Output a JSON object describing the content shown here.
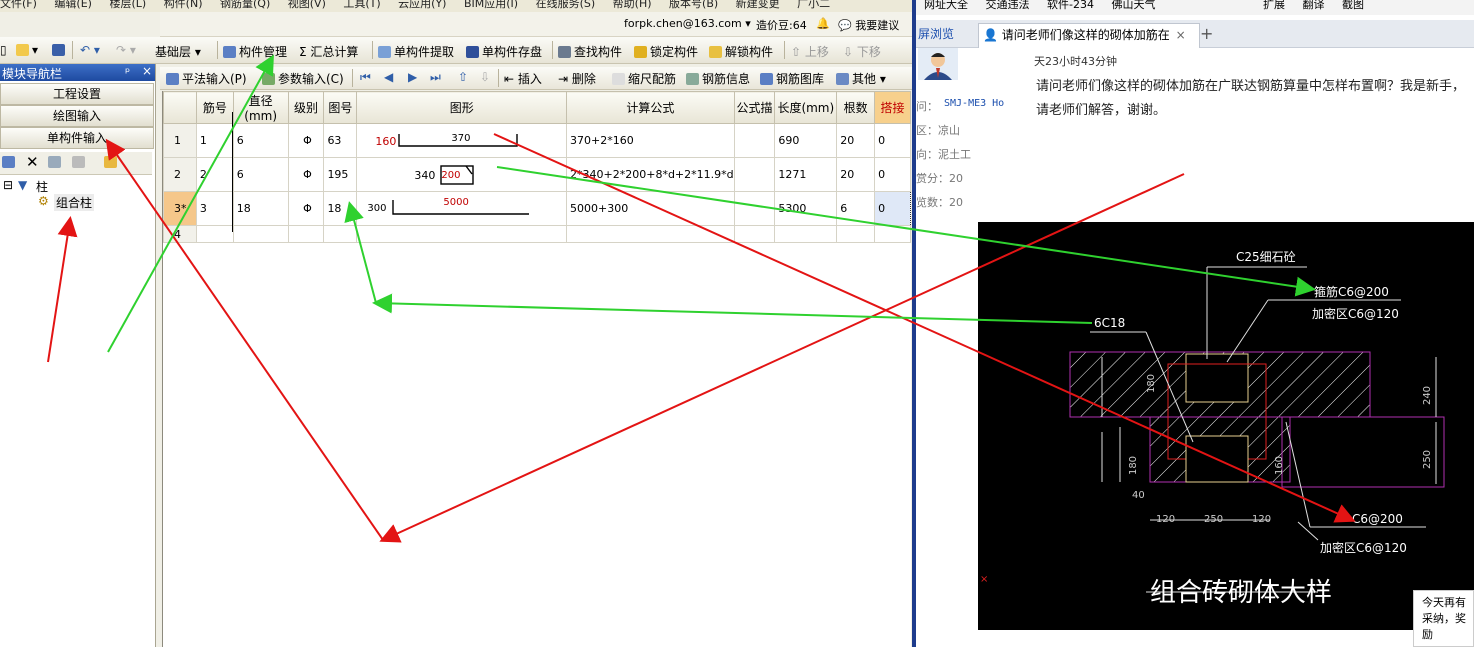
{
  "menubar": [
    "文件(F)",
    "编辑(E)",
    "楼层(L)",
    "构件(N)",
    "钢筋量(Q)",
    "视图(V)",
    "工具(T)",
    "云应用(Y)",
    "BIM应用(I)",
    "在线服务(S)",
    "帮助(H)",
    "版本号(B)",
    "新建变更",
    "广小二"
  ],
  "userbar": {
    "account": "forpk.chen@163.com ▾",
    "price": "造价豆:64",
    "suggest": "我要建议"
  },
  "toolbar1": {
    "floor": "基础层",
    "manage": "构件管理",
    "sum": "汇总计算",
    "extract": "单构件提取",
    "store": "单构件存盘",
    "find": "查找构件",
    "lock": "锁定构件",
    "unlock": "解锁构件",
    "up": "上移",
    "down": "下移"
  },
  "nav": {
    "title": "模块导航栏",
    "pin": "ᵖ",
    "close": "×",
    "items": [
      "工程设置",
      "绘图输入",
      "单构件输入"
    ],
    "tree_root": "柱",
    "tree_child": "组合柱"
  },
  "toolbar2": {
    "flat": "平法输入(P)",
    "param": "参数输入(C)",
    "insert": "插入",
    "delete": "删除",
    "scale": "缩尺配筋",
    "info": "钢筋信息",
    "lib": "钢筋图库",
    "other": "其他 ▾"
  },
  "grid": {
    "headers": [
      "",
      "筋号",
      "直径(mm)",
      "级别",
      "图号",
      "图形",
      "计算公式",
      "公式描",
      "长度(mm)",
      "根数",
      "搭接"
    ],
    "rows": [
      {
        "rn": "1",
        "no": "1",
        "dia": "6",
        "lvl": "Φ",
        "fig": "63",
        "formula": "370+2*160",
        "desc": "",
        "len": "690",
        "count": "20",
        "lap": "0",
        "s1": "160",
        "s2": "370"
      },
      {
        "rn": "2",
        "no": "2",
        "dia": "6",
        "lvl": "Φ",
        "fig": "195",
        "formula": "2*340+2*200+8*d+2*11.9*d",
        "desc": "",
        "len": "1271",
        "count": "20",
        "lap": "0",
        "s1": "340",
        "s2": "200"
      },
      {
        "rn": "3*",
        "no": "3",
        "dia": "18",
        "lvl": "Φ",
        "fig": "18",
        "formula": "5000+300",
        "desc": "",
        "len": "5300",
        "count": "6",
        "lap": "0",
        "s1": "300",
        "s2": "5000"
      },
      {
        "rn": "4",
        "no": "",
        "dia": "",
        "lvl": "",
        "fig": "",
        "formula": "",
        "desc": "",
        "len": "",
        "count": "",
        "lap": ""
      }
    ]
  },
  "browser": {
    "fav": [
      "网址大全",
      "交通违法",
      "软件-234",
      "佛山天气",
      "扩展",
      "翻译",
      "截图"
    ],
    "tab_prev": "屏浏览",
    "tab_active": "请问老师们像这样的砌体加筋在",
    "tab_close": "×",
    "tab_new": "+",
    "time_left": "天23小时43分钟",
    "asker_label": "问：",
    "asker": "SMJ-ME3 Ho",
    "region": "区：凉山",
    "trade": "向：泥土工",
    "score": "赏分：20",
    "views": "览数：20",
    "question": "请问老师们像这样的砌体加筋在广联达钢筋算量中怎样布置啊？我是新手，请老师们解答，谢谢。",
    "notice": [
      "今天再有",
      "采纳，奖励"
    ]
  },
  "cad": {
    "concrete": "C25细石砼",
    "stirrup": "箍筋C6@200",
    "dense": "加密区C6@120",
    "main": "6C18",
    "stirrup2": "C6@200",
    "dense2": "加密区C6@120",
    "title": "组合砖砌体大样",
    "dims": [
      "120",
      "250",
      "120",
      "180",
      "180",
      "240",
      "250",
      "160",
      "40",
      "160"
    ]
  },
  "colors": {
    "arrow_red": "#e31414",
    "arrow_green": "#2fd12f",
    "nav_title": "#1e4aa0",
    "highlight": "#f5c78a"
  }
}
